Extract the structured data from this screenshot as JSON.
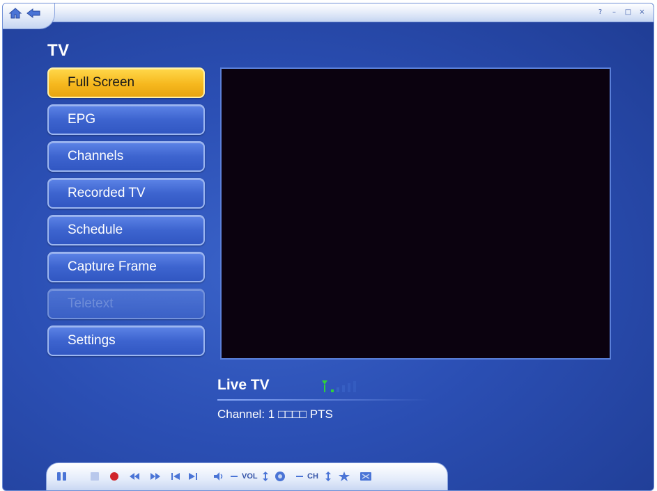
{
  "window": {
    "help_glyph": "?",
    "minimize_glyph": "–",
    "maximize_glyph": "□",
    "close_glyph": "×"
  },
  "section_title": "TV",
  "menu": [
    {
      "label": "Full Screen",
      "state": "selected"
    },
    {
      "label": "EPG",
      "state": "normal"
    },
    {
      "label": "Channels",
      "state": "normal"
    },
    {
      "label": "Recorded TV",
      "state": "normal"
    },
    {
      "label": "Schedule",
      "state": "normal"
    },
    {
      "label": "Capture Frame",
      "state": "normal"
    },
    {
      "label": "Teletext",
      "state": "disabled"
    },
    {
      "label": "Settings",
      "state": "normal"
    }
  ],
  "status": {
    "title": "Live TV",
    "channel_text": "Channel: 1 □□□□ PTS"
  },
  "transport": {
    "vol_label": "VOL",
    "ch_label": "CH"
  },
  "colors": {
    "accent_selected": "#f6b81e",
    "background": "#2b4fb4",
    "signal_green": "#2fd33a"
  }
}
